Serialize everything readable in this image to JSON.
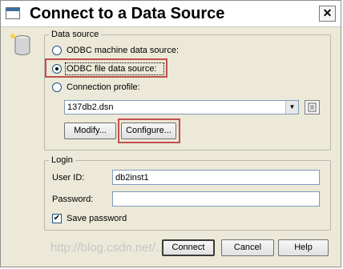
{
  "window": {
    "title": "Connect to a Data Source",
    "close_symbol": "✕"
  },
  "data_source": {
    "legend": "Data source",
    "options": [
      {
        "label": "ODBC machine data source:",
        "selected": false
      },
      {
        "label": "ODBC file data source:",
        "selected": true
      },
      {
        "label": "Connection profile:",
        "selected": false
      }
    ],
    "file_dsn": "137db2.dsn",
    "modify_label": "Modify...",
    "configure_label": "Configure..."
  },
  "login": {
    "legend": "Login",
    "user_id_label": "User ID:",
    "user_id_value": "db2inst1",
    "password_label": "Password:",
    "password_value": "",
    "save_password_label": "Save password",
    "save_password_checked": true
  },
  "buttons": {
    "connect": "Connect",
    "cancel": "Cancel",
    "help": "Help"
  },
  "watermark": "http://blog.csdn.net/...",
  "colors": {
    "highlight": "#c0504d",
    "window_bg": "#ece9d8"
  }
}
